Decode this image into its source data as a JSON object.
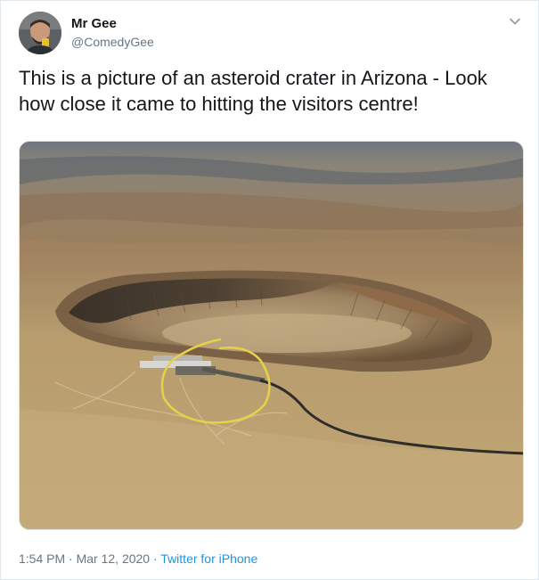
{
  "user": {
    "name": "Mr Gee",
    "handle": "@ComedyGee"
  },
  "tweet": {
    "text": "This is a picture of an asteroid crater in Arizona - Look how close it came to hitting the visitors centre!"
  },
  "meta": {
    "time": "1:54 PM",
    "separator": " · ",
    "date": "Mar 12, 2020",
    "source": "Twitter for iPhone"
  },
  "icons": {
    "menu": "chevron-down-icon",
    "avatar": "avatar"
  },
  "colors": {
    "link": "#1b95e0",
    "secondary_text": "#657786",
    "annotation": "#e6d24a"
  }
}
